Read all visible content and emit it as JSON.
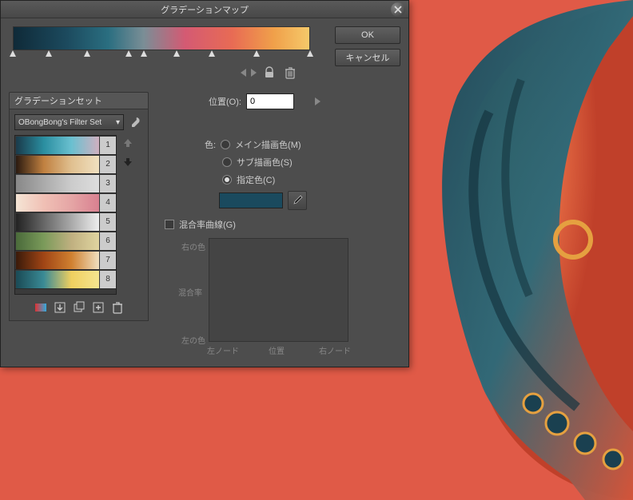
{
  "dialog": {
    "title": "グラデーションマップ",
    "ok": "OK",
    "cancel": "キャンセル"
  },
  "gradient": {
    "stops_pct": [
      0,
      12,
      25,
      39,
      44,
      55,
      67,
      82,
      100
    ]
  },
  "position": {
    "label": "位置(O):",
    "value": "0"
  },
  "presets": {
    "header": "グラデーションセット",
    "selected": "OBongBong's Filter Set",
    "items": [
      {
        "n": "1",
        "g": "linear-gradient(90deg,#1a3a4a,#2a8ea0,#6ac0d0,#d0b0c0)"
      },
      {
        "n": "2",
        "g": "linear-gradient(90deg,#2a1a10,#c08040,#e0c090,#f0e0c0)"
      },
      {
        "n": "3",
        "g": "linear-gradient(90deg,#888,#aaa,#ccc,#ddd)"
      },
      {
        "n": "4",
        "g": "linear-gradient(90deg,#f5e5d5,#f0c0b5,#e5a5a5,#d88090)"
      },
      {
        "n": "5",
        "g": "linear-gradient(90deg,#222,#666,#aaa,#eee)"
      },
      {
        "n": "6",
        "g": "linear-gradient(90deg,#4a6a3a,#7a9a5a,#c0b080,#e0d5a0)"
      },
      {
        "n": "7",
        "g": "linear-gradient(90deg,#3a1a0a,#a04515,#d08030,#f0e0c0)"
      },
      {
        "n": "8",
        "g": "linear-gradient(90deg,#1a4a55,#3a8a95,#f0d060,#f5e590)"
      }
    ]
  },
  "color": {
    "label": "色:",
    "main": "メイン描画色(M)",
    "sub": "サブ描画色(S)",
    "specified": "指定色(C)",
    "swatch": "#1a4a5e"
  },
  "mix": {
    "label": "混合率曲線(G)",
    "right_color": "右の色",
    "rate": "混合率",
    "left_color": "左の色",
    "left_node": "左ノード",
    "pos": "位置",
    "right_node": "右ノード"
  }
}
